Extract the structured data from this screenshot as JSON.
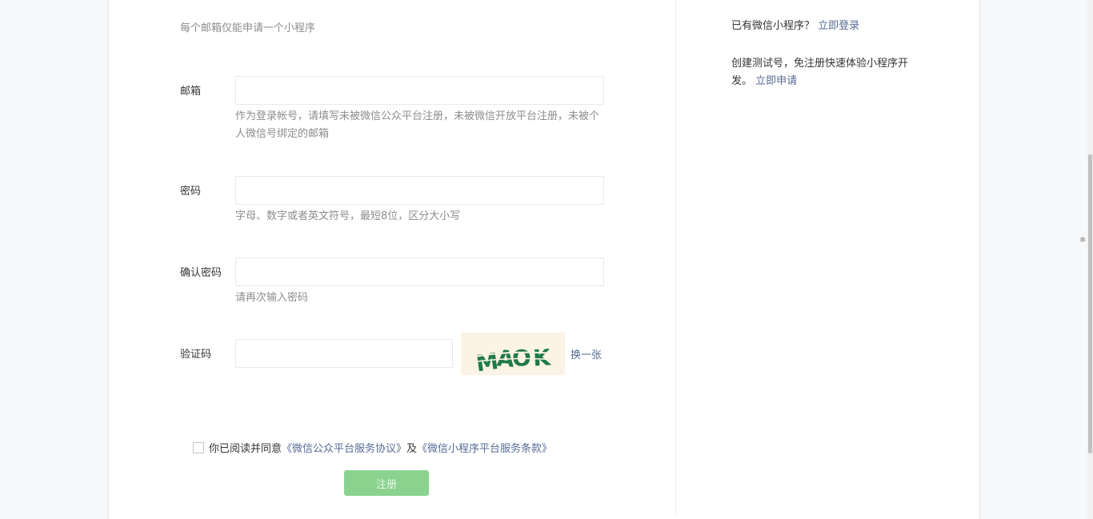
{
  "form": {
    "tip": "每个邮箱仅能申请一个小程序",
    "email": {
      "label": "邮箱",
      "value": "",
      "placeholder": "",
      "hint": "作为登录帐号，请填写未被微信公众平台注册，未被微信开放平台注册，未被个人微信号绑定的邮箱"
    },
    "password": {
      "label": "密码",
      "value": "",
      "placeholder": "",
      "hint": "字母、数字或者英文符号，最短8位，区分大小写"
    },
    "confirm_password": {
      "label": "确认密码",
      "value": "",
      "placeholder": "",
      "hint": "请再次输入密码"
    },
    "captcha": {
      "label": "验证码",
      "value": "",
      "placeholder": "",
      "image_text": "MAOK",
      "refresh_label": "换一张"
    },
    "agreement": {
      "checked": false,
      "prefix": "你已阅读并同意",
      "link1": "《微信公众平台服务协议》",
      "conjunction": "及",
      "link2": "《微信小程序平台服务条款》"
    },
    "submit_label": "注册"
  },
  "sidebar": {
    "login_prompt": "已有微信小程序？",
    "login_link": "立即登录",
    "test_text": "创建测试号，免注册快速体验小程序开发。",
    "test_link": "立即申请"
  },
  "colors": {
    "link": "#576b95",
    "button_disabled": "#8bd28e",
    "captcha_bg": "#fbf3e6",
    "captcha_text": "#1e7a4a"
  }
}
